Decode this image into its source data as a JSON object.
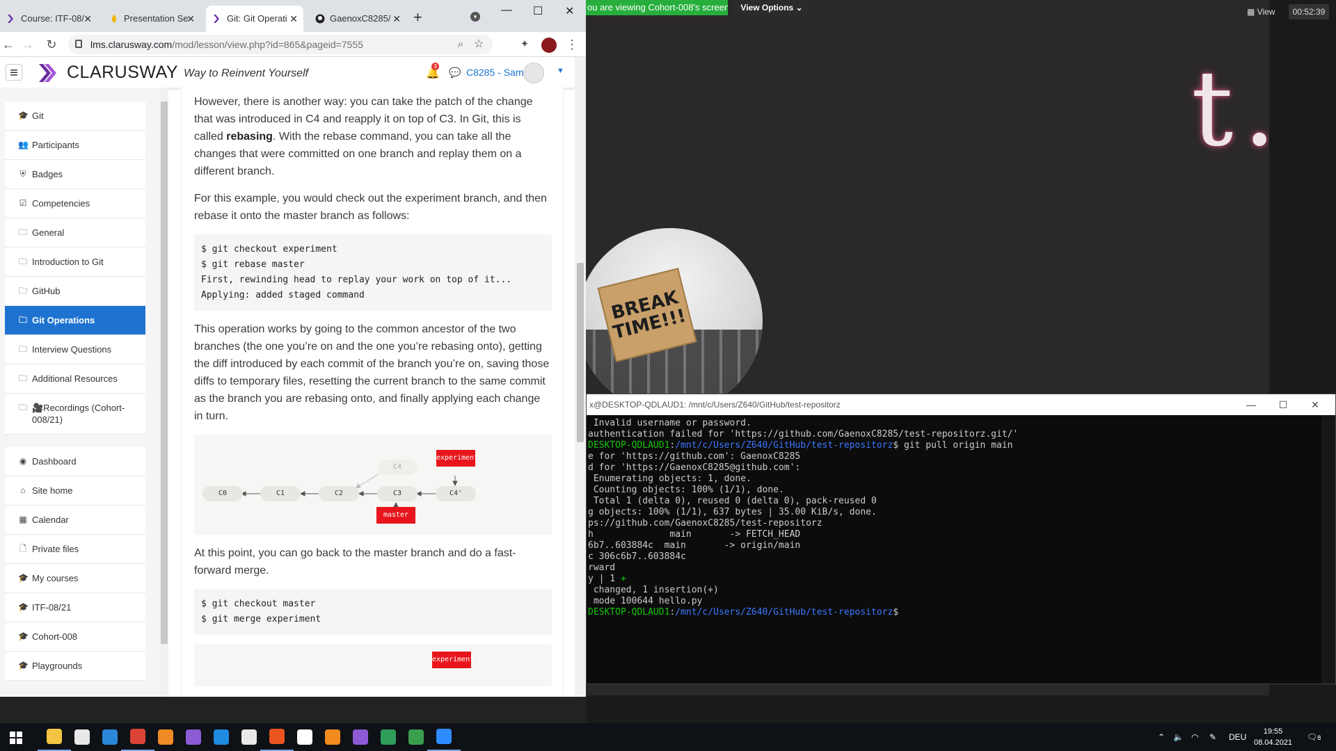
{
  "browser": {
    "tabs": [
      {
        "label": "Course: ITF-08/",
        "icon": "clarusway-icon"
      },
      {
        "label": "Presentation Se",
        "icon": "slides-icon"
      },
      {
        "label": "Git: Git Operati",
        "icon": "clarusway-icon"
      },
      {
        "label": "GaenoxC8285/",
        "icon": "github-icon"
      }
    ],
    "url_host": "lms.clarusway.com",
    "url_path": "/mod/lesson/view.php?id=865&pageid=7555"
  },
  "site": {
    "brand": "CLARUSWAY",
    "tagline": "Way to Reinvent Yourself",
    "notif_count": "3",
    "user": "C8285 - Sami"
  },
  "sidebar": {
    "items": [
      {
        "label": "Git",
        "icon": "graduation-cap-icon"
      },
      {
        "label": "Participants",
        "icon": "users-icon"
      },
      {
        "label": "Badges",
        "icon": "shield-icon"
      },
      {
        "label": "Competencies",
        "icon": "checkbox-icon"
      },
      {
        "label": "General",
        "icon": "folder-icon"
      },
      {
        "label": "Introduction to Git",
        "icon": "folder-icon"
      },
      {
        "label": "GitHub",
        "icon": "folder-icon"
      },
      {
        "label": "Git Operations",
        "icon": "folder-icon",
        "active": true
      },
      {
        "label": "Interview Questions",
        "icon": "folder-icon"
      },
      {
        "label": "Additional Resources",
        "icon": "folder-icon"
      },
      {
        "label": "🎥Recordings (Cohort-008/21)",
        "icon": "folder-icon"
      }
    ],
    "items2": [
      {
        "label": "Dashboard",
        "icon": "dashboard-icon"
      },
      {
        "label": "Site home",
        "icon": "home-icon"
      },
      {
        "label": "Calendar",
        "icon": "calendar-icon"
      },
      {
        "label": "Private files",
        "icon": "file-icon"
      },
      {
        "label": "My courses",
        "icon": "graduation-cap-icon"
      },
      {
        "label": "ITF-08/21",
        "icon": "graduation-cap-icon"
      },
      {
        "label": "Cohort-008",
        "icon": "graduation-cap-icon"
      },
      {
        "label": "Playgrounds",
        "icon": "graduation-cap-icon"
      }
    ]
  },
  "lesson": {
    "p1_a": "However, there is another way: you can take the patch of the change that was introduced in C4 and reapply it on top of C3. In Git, this is called ",
    "p1_bold": "rebasing",
    "p1_b": ". With the rebase command, you can take all the changes that were committed on one branch and replay them on a different branch.",
    "p2": "For this example, you would check out the experiment branch, and then rebase it onto the master branch as follows:",
    "code1": "$ git checkout experiment\n$ git rebase master\nFirst, rewinding head to replay your work on top of it...\nApplying: added staged command",
    "p3": "This operation works by going to the common ancestor of the two branches (the one you’re on and the one you’re rebasing onto), getting the diff introduced by each commit of the branch you’re on, saving those diffs to temporary files, resetting the current branch to the same commit as the branch you are rebasing onto, and finally applying each change in turn.",
    "diagram": {
      "nodes": [
        "C0",
        "C1",
        "C2",
        "C3",
        "C4'"
      ],
      "faded_node": "C4",
      "tag_experiment": "experiment",
      "tag_master": "master"
    },
    "p4": "At this point, you can go back to the master branch and do a fast-forward merge.",
    "code2": "$ git checkout master\n$ git merge experiment",
    "tag_experiment_bottom": "experiment"
  },
  "zoom": {
    "banner": "ou are viewing Cohort-008's screen",
    "view_options": "View Options ⌄",
    "view_label": "View",
    "timer": "00:52:39",
    "big_text": "t. Ara...",
    "sign_text": "BREAK TIME!!!"
  },
  "terminal": {
    "title": "x@DESKTOP-QDLAUD1: /mnt/c/Users/Z640/GitHub/test-repositorz",
    "lines": [
      {
        "parts": [
          {
            "t": " Invalid username or password."
          }
        ]
      },
      {
        "parts": [
          {
            "t": "authentication failed for 'https://github.com/GaenoxC8285/test-repositorz.git/'"
          }
        ]
      },
      {
        "parts": [
          {
            "t": "DESKTOP-QDLAUD1",
            "c": "t-green"
          },
          {
            "t": ":"
          },
          {
            "t": "/mnt/c/Users/Z640/GitHub/test-repositorz",
            "c": "t-blue"
          },
          {
            "t": "$ git pull origin main"
          }
        ]
      },
      {
        "parts": [
          {
            "t": "e for 'https://github.com': GaenoxC8285"
          }
        ]
      },
      {
        "parts": [
          {
            "t": "d for 'https://GaenoxC8285@github.com':"
          }
        ]
      },
      {
        "parts": [
          {
            "t": " Enumerating objects: 1, done."
          }
        ]
      },
      {
        "parts": [
          {
            "t": " Counting objects: 100% (1/1), done."
          }
        ]
      },
      {
        "parts": [
          {
            "t": " Total 1 (delta 0), reused 0 (delta 0), pack-reused 0"
          }
        ]
      },
      {
        "parts": [
          {
            "t": "g objects: 100% (1/1), 637 bytes | 35.00 KiB/s, done."
          }
        ]
      },
      {
        "parts": [
          {
            "t": "ps://github.com/GaenoxC8285/test-repositorz"
          }
        ]
      },
      {
        "parts": [
          {
            "t": "h              main       -> FETCH_HEAD"
          }
        ]
      },
      {
        "parts": [
          {
            "t": "6b7..603884c  main       -> origin/main"
          }
        ]
      },
      {
        "parts": [
          {
            "t": "c 306c6b7..603884c"
          }
        ]
      },
      {
        "parts": [
          {
            "t": "rward"
          }
        ]
      },
      {
        "parts": [
          {
            "t": "y | 1 "
          },
          {
            "t": "+",
            "c": "t-green"
          }
        ]
      },
      {
        "parts": [
          {
            "t": " changed, 1 insertion(+)"
          }
        ]
      },
      {
        "parts": [
          {
            "t": " mode 100644 hello.py"
          }
        ]
      },
      {
        "parts": [
          {
            "t": "DESKTOP-QDLAUD1",
            "c": "t-green"
          },
          {
            "t": ":"
          },
          {
            "t": "/mnt/c/Users/Z640/GitHub/test-repositorz",
            "c": "t-blue"
          },
          {
            "t": "$"
          }
        ]
      }
    ]
  },
  "taskbar": {
    "apps": [
      {
        "name": "file-explorer-icon",
        "color": "#f3c542",
        "running": true
      },
      {
        "name": "store-icon",
        "color": "#e8e8e8",
        "running": false
      },
      {
        "name": "mail-icon",
        "color": "#2b88d8",
        "running": false
      },
      {
        "name": "chrome-icon",
        "color": "#db4437",
        "running": true
      },
      {
        "name": "blender-icon",
        "color": "#f08a24",
        "running": false
      },
      {
        "name": "visual-studio-icon",
        "color": "#8b5cd6",
        "running": false
      },
      {
        "name": "vscode-icon",
        "color": "#1e8be0",
        "running": false
      },
      {
        "name": "slack-icon",
        "color": "#e8e8e8",
        "running": false
      },
      {
        "name": "ubuntu-icon",
        "color": "#e95420",
        "running": true
      },
      {
        "name": "notepad-icon",
        "color": "#ffffff",
        "running": false
      },
      {
        "name": "vlc-icon",
        "color": "#f28b1d",
        "running": false
      },
      {
        "name": "github-desktop-icon",
        "color": "#8e5bd6",
        "running": false
      },
      {
        "name": "chrome-dev-icon",
        "color": "#2f9e5b",
        "running": false
      },
      {
        "name": "chrome-alt-icon",
        "color": "#3b9e4f",
        "running": false
      },
      {
        "name": "zoom-icon",
        "color": "#2d8cff",
        "running": true
      }
    ],
    "lang": "DEU",
    "time": "19:55",
    "date": "08.04.2021",
    "notif_count": "8"
  }
}
